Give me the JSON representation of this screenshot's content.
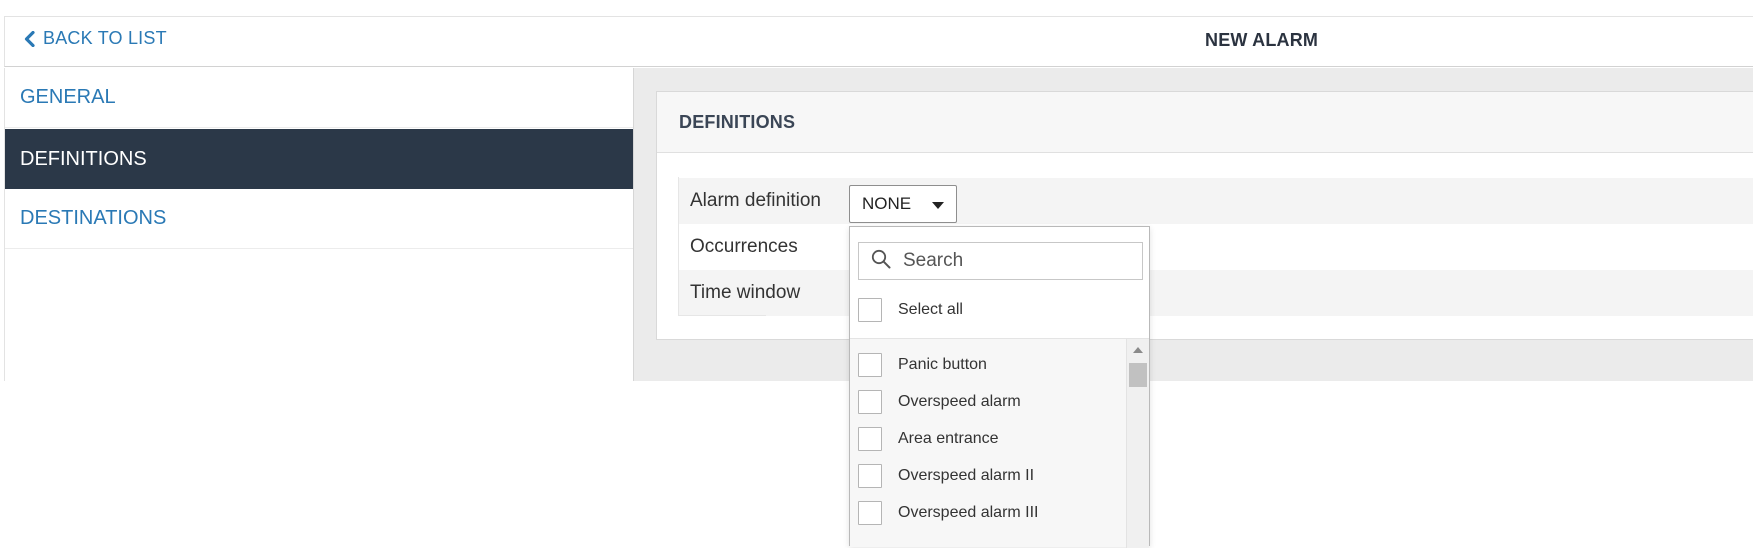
{
  "header": {
    "back_label": "BACK TO LIST",
    "page_title": "NEW ALARM"
  },
  "sidebar": {
    "items": [
      {
        "label": "GENERAL",
        "active": false
      },
      {
        "label": "DEFINITIONS",
        "active": true
      },
      {
        "label": "DESTINATIONS",
        "active": false
      }
    ]
  },
  "panel": {
    "title": "DEFINITIONS",
    "rows": [
      {
        "label": "Alarm definition"
      },
      {
        "label": "Occurrences"
      },
      {
        "label": "Time window"
      }
    ]
  },
  "select": {
    "value": "NONE"
  },
  "dropdown": {
    "search_placeholder": "Search",
    "select_all_label": "Select all",
    "options": [
      {
        "label": "Panic button",
        "checked": false
      },
      {
        "label": "Overspeed alarm",
        "checked": false
      },
      {
        "label": "Area entrance",
        "checked": false
      },
      {
        "label": "Overspeed alarm II",
        "checked": false
      },
      {
        "label": "Overspeed alarm III",
        "checked": false
      }
    ]
  },
  "colors": {
    "link": "#2a79b5",
    "active_nav_bg": "#2b3848",
    "title_text": "#2b3340"
  }
}
